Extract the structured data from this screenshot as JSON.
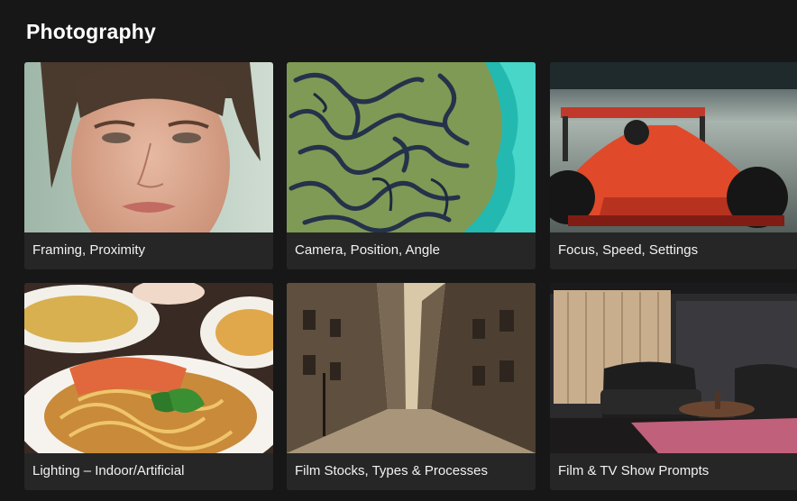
{
  "section": {
    "title": "Photography"
  },
  "cards": [
    {
      "label": "Framing, Proximity",
      "image": "close-up portrait of a young woman"
    },
    {
      "label": "Camera, Position, Angle",
      "image": "aerial view of maze-like forest by water"
    },
    {
      "label": "Focus, Speed, Settings",
      "image": "red formula race car on track"
    },
    {
      "label": "Lighting – Indoor/Artificial",
      "image": "plate of pasta with salmon and basil"
    },
    {
      "label": "Film Stocks, Types & Processes",
      "image": "sepia old city street"
    },
    {
      "label": "Film & TV Show Prompts",
      "image": "studio set with leather sofas"
    }
  ],
  "colors": {
    "background": "#171717",
    "card": "#262626",
    "text": "#f2f2f2"
  }
}
